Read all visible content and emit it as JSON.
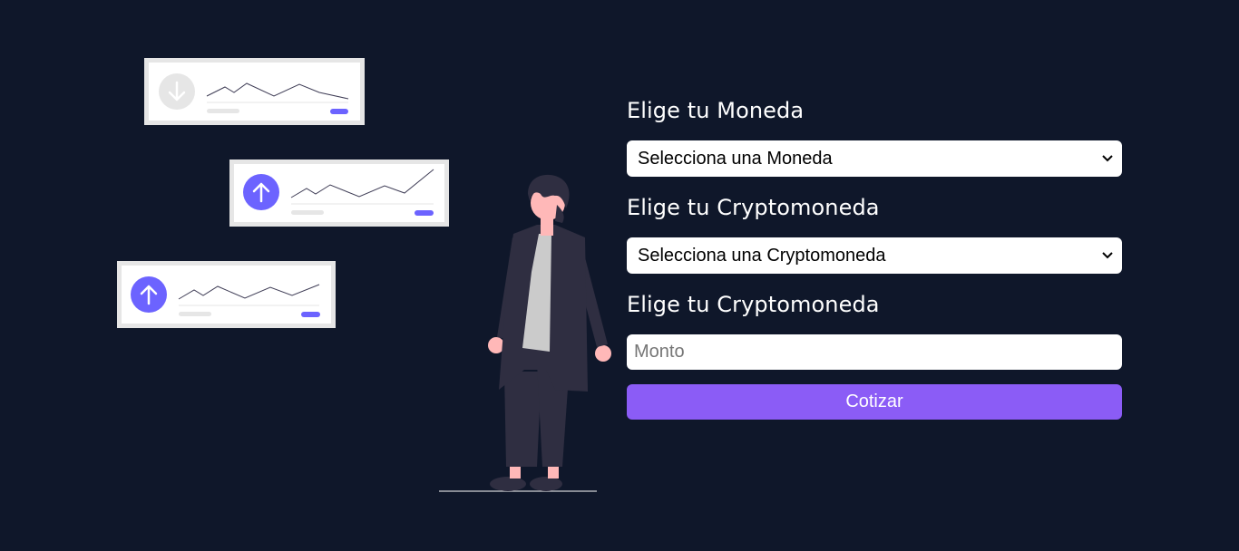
{
  "form": {
    "currency_label": "Elige tu Moneda",
    "currency_select_value": "Selecciona una Moneda",
    "crypto_label": "Elige tu Cryptomoneda",
    "crypto_select_value": "Selecciona una Cryptomoneda",
    "amount_label": "Elige tu Cryptomoneda",
    "amount_placeholder": "Monto",
    "submit_label": "Cotizar"
  },
  "icons": {
    "card_1": "arrow-down-icon",
    "card_2": "arrow-up-icon",
    "card_3": "arrow-up-icon",
    "select_caret": "chevron-down-icon"
  },
  "colors": {
    "background": "#0f172a",
    "accent": "#8b5cf6",
    "illustration_accent": "#6c63ff",
    "text": "#ffffff"
  }
}
